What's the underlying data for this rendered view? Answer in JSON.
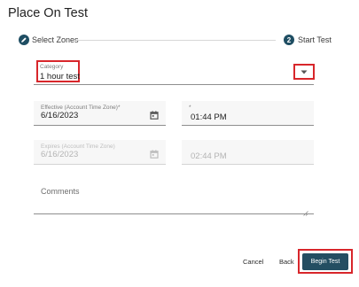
{
  "dialog": {
    "title": "Place On Test"
  },
  "stepper": {
    "step1": {
      "label": "Select Zones"
    },
    "step2": {
      "number": "2",
      "label": "Start Test"
    }
  },
  "category": {
    "label": "Category",
    "value": "1 hour test"
  },
  "effective": {
    "label": "Effective (Account Time Zone)*",
    "date": "6/16/2023",
    "time_label": "*",
    "time": "01:44 PM"
  },
  "expires": {
    "label": "Expires (Account Time Zone)",
    "date": "6/16/2023",
    "time": "02:44 PM"
  },
  "comments": {
    "placeholder": "Comments"
  },
  "actions": {
    "cancel": "Cancel",
    "back": "Back",
    "begin": "Begin Test"
  },
  "colors": {
    "accent": "#244e62",
    "highlight": "#d8262b"
  }
}
